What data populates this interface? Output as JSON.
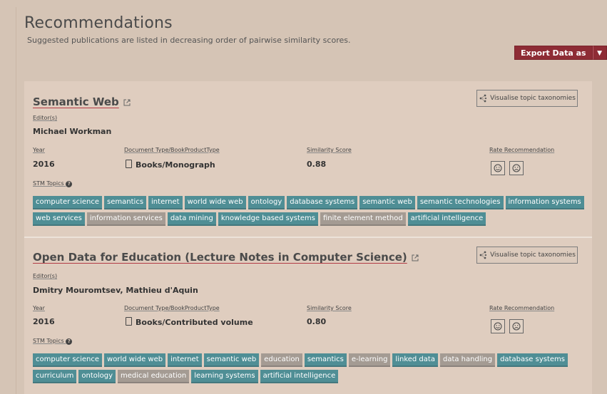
{
  "header": {
    "title": "Recommendations",
    "subtitle": "Suggested publications are listed in decreasing order of pairwise similarity scores.",
    "export_label": "Export Data as"
  },
  "labels": {
    "editors": "Editor(s)",
    "year": "Year",
    "doc_type": "Document Type/BookProductType",
    "similarity": "Similarity Score",
    "rate": "Rate Recommendation",
    "stm_topics": "STM Topics",
    "visualise": "Visualise topic taxonomies"
  },
  "colors": {
    "accent": "#8e2c35",
    "tag_teal": "#4f8e95",
    "tag_grey": "#a49b93",
    "background": "#d5c4b5"
  },
  "recommendations": [
    {
      "title": "Semantic Web",
      "editors": "Michael Workman",
      "year": "2016",
      "doc_type": "Books/Monograph",
      "similarity": "0.88",
      "tags": [
        {
          "label": "computer science",
          "color": "teal"
        },
        {
          "label": "semantics",
          "color": "teal"
        },
        {
          "label": "internet",
          "color": "teal"
        },
        {
          "label": "world wide web",
          "color": "teal"
        },
        {
          "label": "ontology",
          "color": "teal"
        },
        {
          "label": "database systems",
          "color": "teal"
        },
        {
          "label": "semantic web",
          "color": "teal"
        },
        {
          "label": "semantic technologies",
          "color": "teal"
        },
        {
          "label": "information systems",
          "color": "teal"
        },
        {
          "label": "web services",
          "color": "teal"
        },
        {
          "label": "information services",
          "color": "grey"
        },
        {
          "label": "data mining",
          "color": "teal"
        },
        {
          "label": "knowledge based systems",
          "color": "teal"
        },
        {
          "label": "finite element method",
          "color": "grey"
        },
        {
          "label": "artificial intelligence",
          "color": "teal"
        }
      ]
    },
    {
      "title": "Open Data for Education (Lecture Notes in Computer Science)",
      "editors": "Dmitry Mouromtsev, Mathieu d'Aquin",
      "year": "2016",
      "doc_type": "Books/Contributed volume",
      "similarity": "0.80",
      "tags": [
        {
          "label": "computer science",
          "color": "teal"
        },
        {
          "label": "world wide web",
          "color": "teal"
        },
        {
          "label": "internet",
          "color": "teal"
        },
        {
          "label": "semantic web",
          "color": "teal"
        },
        {
          "label": "education",
          "color": "grey"
        },
        {
          "label": "semantics",
          "color": "teal"
        },
        {
          "label": "e-learning",
          "color": "grey"
        },
        {
          "label": "linked data",
          "color": "teal"
        },
        {
          "label": "data handling",
          "color": "grey"
        },
        {
          "label": "database systems",
          "color": "teal"
        },
        {
          "label": "curriculum",
          "color": "teal"
        },
        {
          "label": "ontology",
          "color": "teal"
        },
        {
          "label": "medical education",
          "color": "grey"
        },
        {
          "label": "learning systems",
          "color": "teal"
        },
        {
          "label": "artificial intelligence",
          "color": "teal"
        }
      ]
    }
  ]
}
